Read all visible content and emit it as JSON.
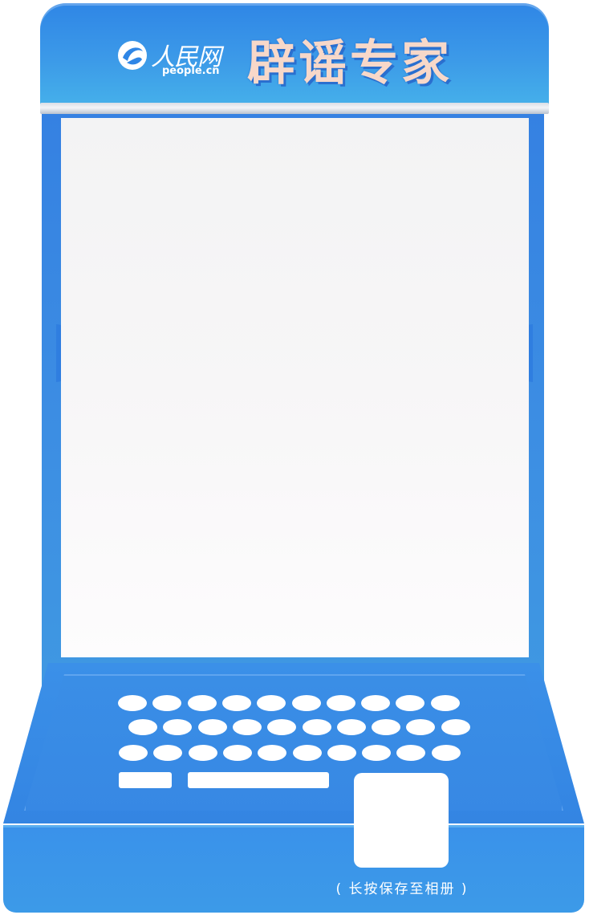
{
  "header": {
    "logo_cn": "人民网",
    "logo_en": "people.cn",
    "title": "辟谣专家"
  },
  "base": {
    "save_hint": "( 长按保存至相册 )"
  },
  "keyboard": {
    "rows": [
      10,
      10,
      10
    ]
  },
  "colors": {
    "frame_blue": "#3581e2",
    "title_peach": "#f7d8c9",
    "screen": "#f5f5f6"
  }
}
